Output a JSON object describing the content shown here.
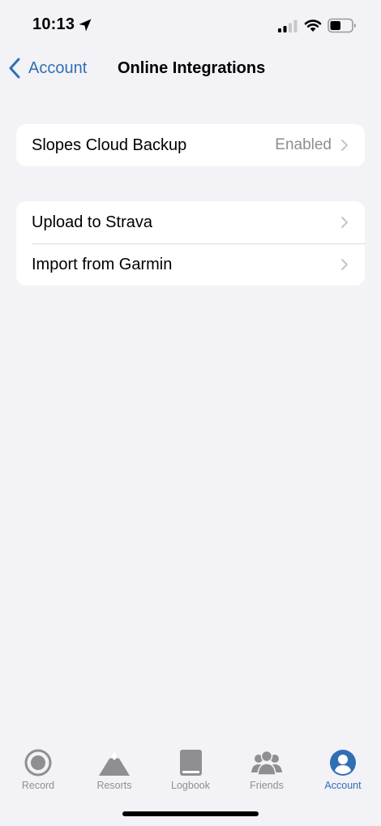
{
  "status_bar": {
    "time": "10:13",
    "icons": [
      "location-arrow-icon",
      "cellular-signal-icon",
      "wifi-icon",
      "battery-icon"
    ]
  },
  "nav": {
    "back_label": "Account",
    "title": "Online Integrations"
  },
  "groups": [
    {
      "rows": [
        {
          "label": "Slopes Cloud Backup",
          "value": "Enabled"
        }
      ]
    },
    {
      "rows": [
        {
          "label": "Upload to Strava"
        },
        {
          "label": "Import from Garmin"
        }
      ]
    }
  ],
  "tab_bar": {
    "tabs": [
      {
        "label": "Record",
        "icon": "record-icon"
      },
      {
        "label": "Resorts",
        "icon": "mountain-icon"
      },
      {
        "label": "Logbook",
        "icon": "book-icon"
      },
      {
        "label": "Friends",
        "icon": "friends-icon"
      },
      {
        "label": "Account",
        "icon": "account-icon",
        "active": true
      }
    ]
  },
  "colors": {
    "accent": "#2f6fb4",
    "background": "#f2f2f7",
    "secondary_text": "#8e8e93",
    "inactive_tab": "#8e8e93"
  }
}
